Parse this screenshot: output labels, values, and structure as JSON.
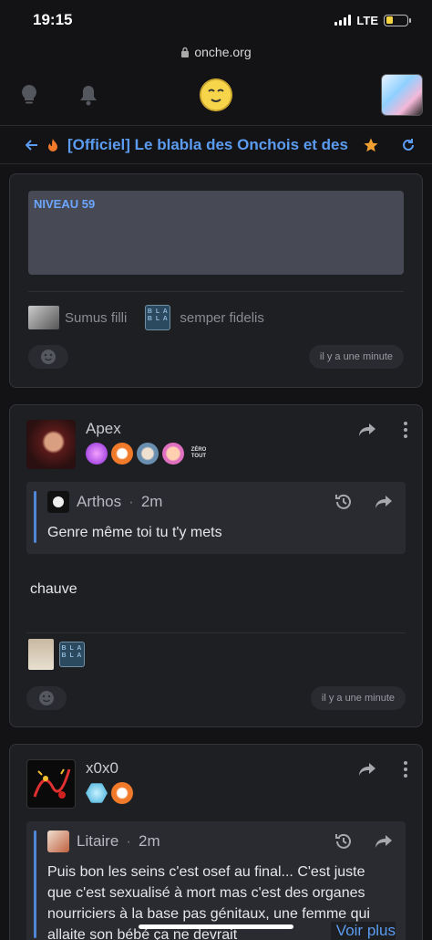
{
  "status_bar": {
    "time": "19:15",
    "network": "LTE",
    "battery_level": 0.35
  },
  "browser": {
    "url": "onche.org"
  },
  "topic": {
    "title": "[Officiel] Le blabla des Onchois et des"
  },
  "colors": {
    "accent": "#5b9cf0",
    "star": "#f0a030",
    "background": "#131316",
    "card": "#1e1f23"
  },
  "card1": {
    "niveau": "NIVEAU 59",
    "sig_text_1": "Sumus filli",
    "sig_text_2": "semper fidelis",
    "time": "il y a une minute"
  },
  "post1": {
    "author": "Apex",
    "quote_author": "Arthos",
    "quote_time": "2m",
    "quote_text": "Genre même toi tu t'y mets",
    "text": "chauve",
    "time": "il y a une minute",
    "badge_zero": "ZÉRO TOUT"
  },
  "post2": {
    "author": "x0x0",
    "quote_author": "Litaire",
    "quote_time": "2m",
    "quote_text": "Puis bon les seins c'est osef au final... C'est juste que c'est sexualisé à mort mas c'est des organes nourriciers à la base pas génitaux, une femme qui allaite son bébé ça ne devrait",
    "voir_plus": "Voir plus"
  },
  "blabla_badge": "BLA BLA"
}
